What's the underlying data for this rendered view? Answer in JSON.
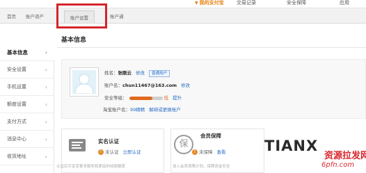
{
  "top_nav": {
    "my_alipay": "我的支付宝",
    "transactions": "交易记录",
    "security": "安全保障",
    "apps": "应用"
  },
  "subnav": {
    "home": "首页",
    "assets": "账户资产",
    "settings": "账户设置",
    "account_link": "账户通"
  },
  "sidebar": {
    "items": [
      {
        "label": "基本信息",
        "active": true
      },
      {
        "label": "安全设置"
      },
      {
        "label": "手机设置"
      },
      {
        "label": "额度设置"
      },
      {
        "label": "支付方式"
      },
      {
        "label": "消息中心"
      },
      {
        "label": "收货地址"
      }
    ]
  },
  "main": {
    "section_title": "基本信息"
  },
  "profile": {
    "name_label": "姓名：",
    "name_value": "张刚云",
    "modify": "修改",
    "user_type": "普通用户",
    "account_label": "账户名：",
    "account_value": "chun11467@163.com",
    "security_label": "安全等级：",
    "security_level": 0.7,
    "security_text": "低",
    "improve": "提升",
    "taobao_label": "淘宝账户名：",
    "taobao_value": "99精睛",
    "taobao_action": "解绑或更换账户"
  },
  "cards": {
    "verify": {
      "title": "实名认证",
      "status": "未认证",
      "action": "立即认证",
      "desc": "认证后可享受更多服务和更高的收款额度"
    },
    "membership": {
      "title": "会员保障",
      "status": "未保障",
      "action": "查看",
      "desc": "加入会员保障计划，保障资金安全"
    }
  },
  "watermark": {
    "logo": "TIANX",
    "cn": "资源拉发网",
    "url": "6pfn.com"
  },
  "colors": {
    "accent_orange": "#e87e0c",
    "highlight_red": "#d3242a",
    "link_blue": "#2a6fc4"
  }
}
